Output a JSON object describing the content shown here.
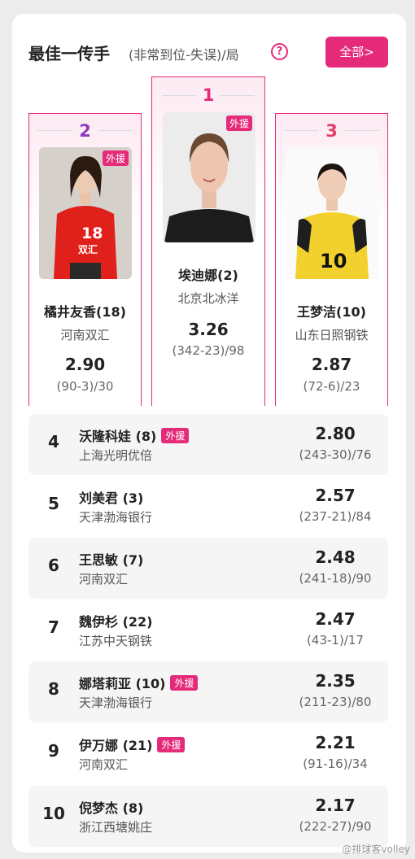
{
  "header": {
    "title": "最佳一传手",
    "subtitle": "(非常到位-失误)/局",
    "help_label": "?",
    "all_button": "全部>"
  },
  "colors": {
    "accent": "#e62a7a",
    "rank2": "#8e3bbf",
    "rank3": "#e03d6a"
  },
  "podium": [
    {
      "rank": "1",
      "tag": "外援",
      "name": "埃迪娜(2)",
      "team": "北京北冰洋",
      "value": "3.26",
      "detail": "(342-23)/98"
    },
    {
      "rank": "2",
      "tag": "外援",
      "name": "橘井友香(18)",
      "team": "河南双汇",
      "value": "2.90",
      "detail": "(90-3)/30",
      "jersey": "18",
      "jersey_text": "双汇"
    },
    {
      "rank": "3",
      "name": "王梦洁(10)",
      "team": "山东日照钢铁",
      "value": "2.87",
      "detail": "(72-6)/23",
      "jersey": "10"
    }
  ],
  "rows": [
    {
      "rank": "4",
      "name": "沃隆科娃 (8)",
      "tag": "外援",
      "team": "上海光明优倍",
      "value": "2.80",
      "detail": "(243-30)/76"
    },
    {
      "rank": "5",
      "name": "刘美君 (3)",
      "tag": "",
      "team": "天津渤海银行",
      "value": "2.57",
      "detail": "(237-21)/84"
    },
    {
      "rank": "6",
      "name": "王思敏 (7)",
      "tag": "",
      "team": "河南双汇",
      "value": "2.48",
      "detail": "(241-18)/90"
    },
    {
      "rank": "7",
      "name": "魏伊杉 (22)",
      "tag": "",
      "team": "江苏中天钢铁",
      "value": "2.47",
      "detail": "(43-1)/17"
    },
    {
      "rank": "8",
      "name": "娜塔莉亚 (10)",
      "tag": "外援",
      "team": "天津渤海银行",
      "value": "2.35",
      "detail": "(211-23)/80"
    },
    {
      "rank": "9",
      "name": "伊万娜 (21)",
      "tag": "外援",
      "team": "河南双汇",
      "value": "2.21",
      "detail": "(91-16)/34"
    },
    {
      "rank": "10",
      "name": "倪梦杰 (8)",
      "tag": "",
      "team": "浙江西塘姚庄",
      "value": "2.17",
      "detail": "(222-27)/90"
    }
  ],
  "watermark": "@排球客volley"
}
